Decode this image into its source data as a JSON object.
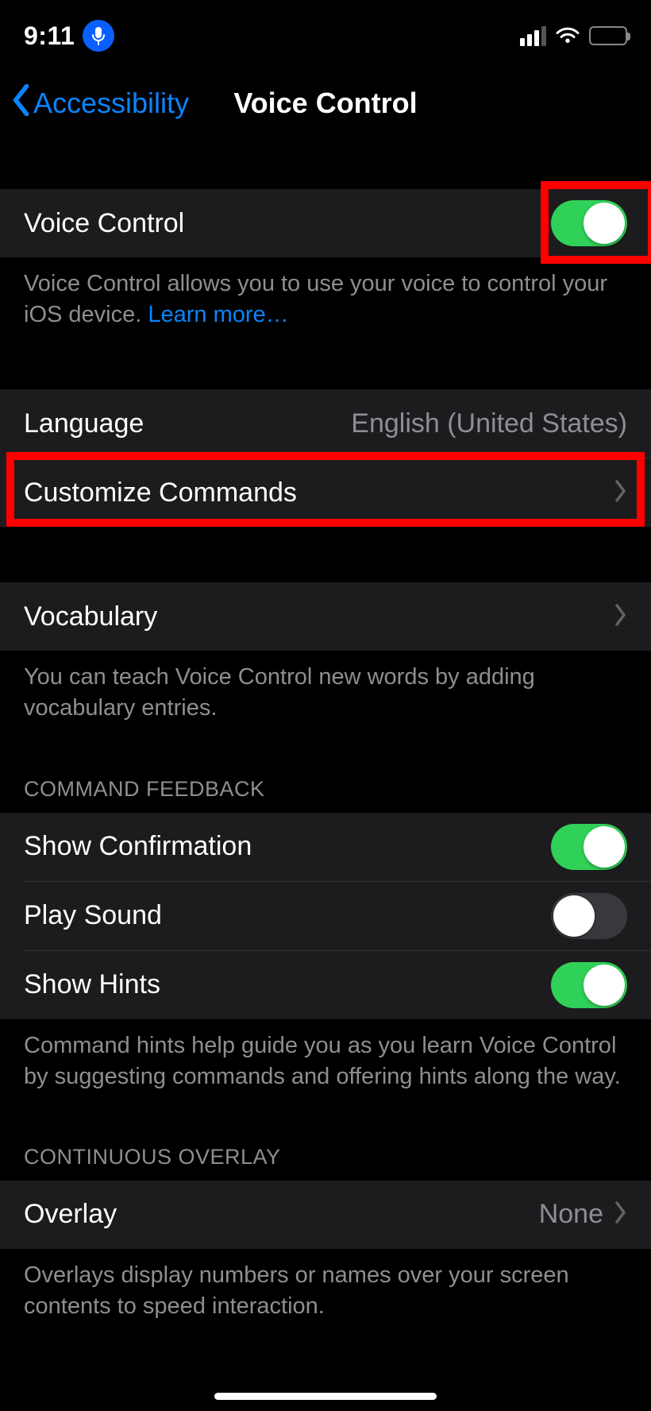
{
  "status_bar": {
    "time": "9:11"
  },
  "nav": {
    "back_label": "Accessibility",
    "title": "Voice Control"
  },
  "group_main": {
    "voice_control_label": "Voice Control",
    "voice_control_on": true,
    "footer": "Voice Control allows you to use your voice to control your iOS device. ",
    "learn_more": "Learn more…"
  },
  "group_lang": {
    "language_label": "Language",
    "language_value": "English (United States)",
    "customize_label": "Customize Commands"
  },
  "group_vocab": {
    "vocabulary_label": "Vocabulary",
    "footer": "You can teach Voice Control new words by adding vocabulary entries."
  },
  "group_feedback": {
    "header": "COMMAND FEEDBACK",
    "show_confirmation_label": "Show Confirmation",
    "show_confirmation_on": true,
    "play_sound_label": "Play Sound",
    "play_sound_on": false,
    "show_hints_label": "Show Hints",
    "show_hints_on": true,
    "footer": "Command hints help guide you as you learn Voice Control by suggesting commands and offering hints along the way."
  },
  "group_overlay": {
    "header": "CONTINUOUS OVERLAY",
    "overlay_label": "Overlay",
    "overlay_value": "None",
    "footer": "Overlays display numbers or names over your screen contents to speed interaction."
  }
}
